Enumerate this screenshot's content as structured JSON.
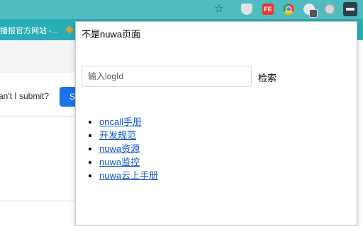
{
  "toolbar": {
    "icons": [
      "star-icon",
      "shield-extension-icon",
      "fe-extension-icon",
      "chrome-extension-icon",
      "cloud-extension-icon",
      "gear-extension-icon",
      "active-extension-icon"
    ],
    "fe_label": "FE",
    "star_glyph": "☆"
  },
  "bookmarks": {
    "item1": "播报官方网站 -..."
  },
  "background_page": {
    "submit_text": "an't I submit?",
    "submit_button_label": "S"
  },
  "popup": {
    "title": "不是nuwa页面",
    "search": {
      "placeholder": "输入logId",
      "value": ""
    },
    "search_button": "检索",
    "links": [
      {
        "label": "oncall手册"
      },
      {
        "label": "开发规范"
      },
      {
        "label": "nuwa资源"
      },
      {
        "label": "nuwa监控"
      },
      {
        "label": "nuwa云上手册"
      }
    ]
  },
  "colors": {
    "toolbar": "#4fbcc2",
    "bookmarks_bar": "#2aaeb5",
    "link": "#1155cc",
    "primary_button": "#1a73e8"
  }
}
